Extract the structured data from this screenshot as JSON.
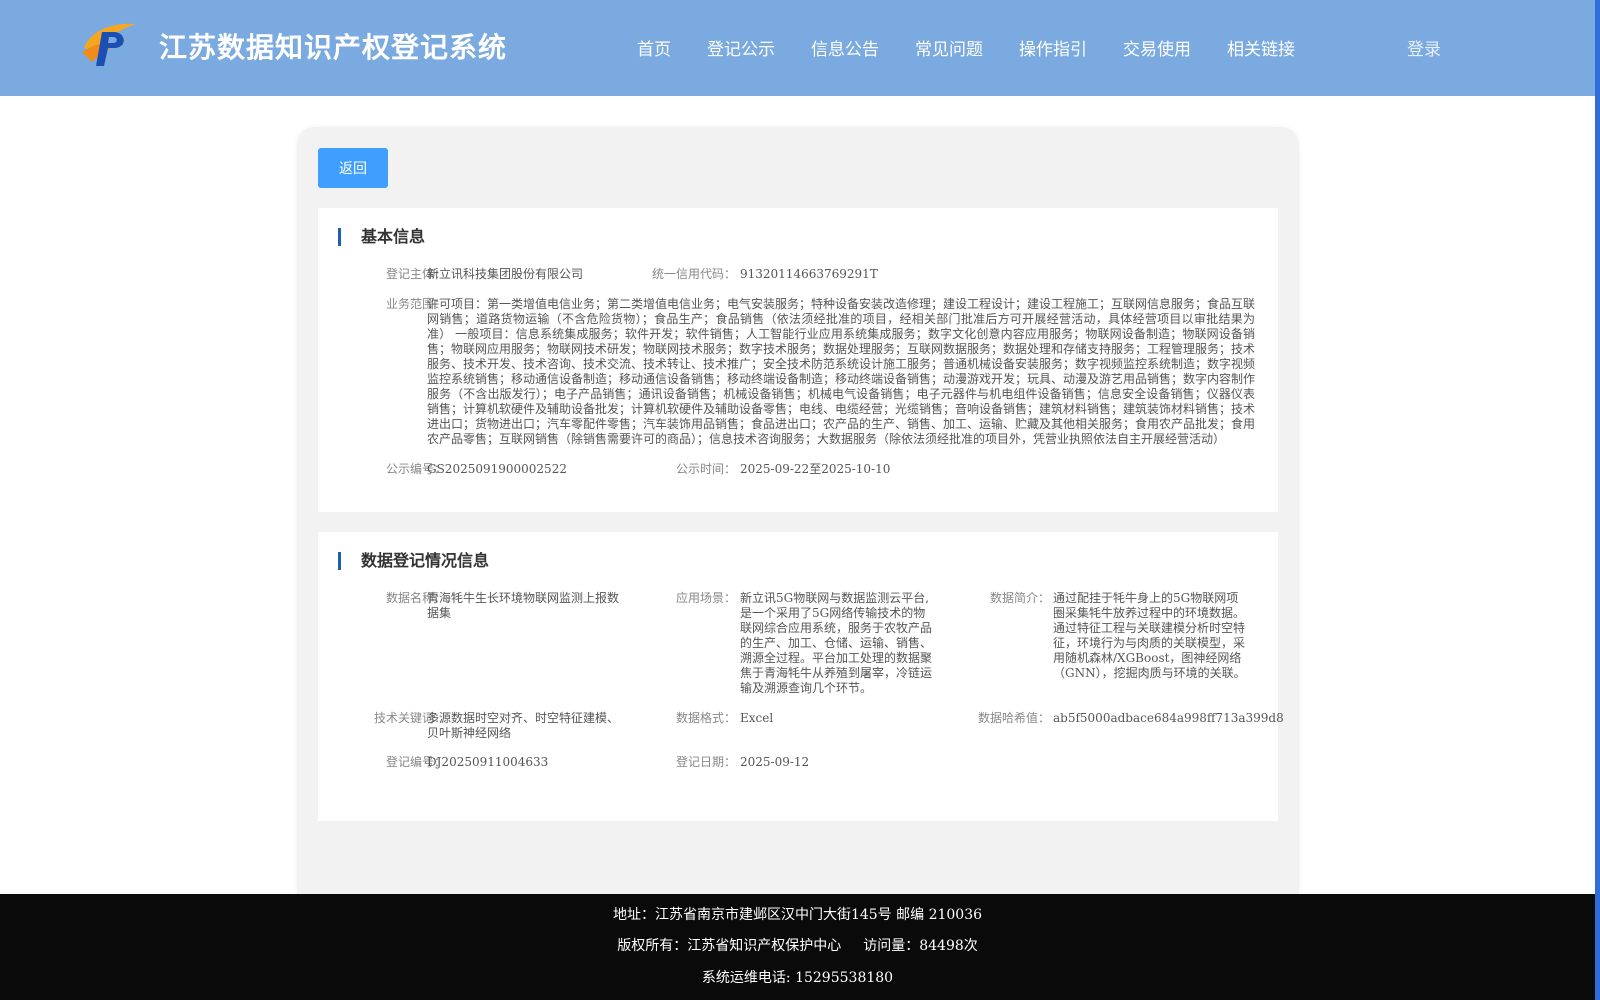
{
  "header": {
    "title": "江苏数据知识产权登记系统",
    "nav": [
      "首页",
      "登记公示",
      "信息公告",
      "常见问题",
      "操作指引",
      "交易使用",
      "相关链接"
    ],
    "login": "登录",
    "colors": {
      "header_bg": "#7aaadf",
      "accent": "#409eff",
      "strip": "#2d6fd6"
    }
  },
  "back_label": "返回",
  "basic": {
    "title": "基本信息",
    "subject_label": "登记主体：",
    "subject": "新立讯科技集团股份有限公司",
    "credit_label": "统一信用代码：",
    "credit": "91320114663769291T",
    "scope_label": "业务范围：",
    "scope": "许可项目：第一类增值电信业务；第二类增值电信业务；电气安装服务；特种设备安装改造修理；建设工程设计；建设工程施工；互联网信息服务；食品互联网销售；道路货物运输（不含危险货物）；食品生产；食品销售（依法须经批准的项目，经相关部门批准后方可开展经营活动，具体经营项目以审批结果为准） 一般项目：信息系统集成服务；软件开发；软件销售；人工智能行业应用系统集成服务；数字文化创意内容应用服务；物联网设备制造；物联网设备销售；物联网应用服务；物联网技术研发；物联网技术服务；数字技术服务；数据处理服务；互联网数据服务；数据处理和存储支持服务；工程管理服务；技术服务、技术开发、技术咨询、技术交流、技术转让、技术推广；安全技术防范系统设计施工服务；普通机械设备安装服务；数字视频监控系统制造；数字视频监控系统销售；移动通信设备制造；移动通信设备销售；移动终端设备制造；移动终端设备销售；动漫游戏开发；玩具、动漫及游艺用品销售；数字内容制作服务（不含出版发行）；电子产品销售；通讯设备销售；机械设备销售；机械电气设备销售；电子元器件与机电组件设备销售；信息安全设备销售；仪器仪表销售；计算机软硬件及辅助设备批发；计算机软硬件及辅助设备零售；电线、电缆经营；光缆销售；音响设备销售；建筑材料销售；建筑装饰材料销售；技术进出口；货物进出口；汽车零配件零售；汽车装饰用品销售；食品进出口；农产品的生产、销售、加工、运输、贮藏及其他相关服务；食用农产品批发；食用农产品零售；互联网销售（除销售需要许可的商品）；信息技术咨询服务；大数据服务（除依法须经批准的项目外，凭营业执照依法自主开展经营活动）",
    "pub_no_label": "公示编号：",
    "pub_no": "GS2025091900002522",
    "pub_time_label": "公示时间：",
    "pub_start": "2025-09-22",
    "pub_to": "至",
    "pub_end": "2025-10-10"
  },
  "reg": {
    "title": "数据登记情况信息",
    "name_label": "数据名称：",
    "name": "青海牦牛生长环境物联网监测上报数据集",
    "scene_label": "应用场景：",
    "scene": "新立讯5G物联网与数据监测云平台,是一个采用了5G网络传输技术的物联网综合应用系统，服务于农牧产品的生产、加工、仓储、运输、销售、溯源全过程。平台加工处理的数据聚焦于青海牦牛从养殖到屠宰，冷链运输及溯源查询几个环节。",
    "intro_label": "数据简介：",
    "intro": "通过配挂于牦牛身上的5G物联网项圈采集牦牛放养过程中的环境数据。通过特征工程与关联建模分析时空特征，环境行为与肉质的关联模型，采用随机森林/XGBoost，图神经网络（GNN），挖掘肉质与环境的关联。",
    "keywords_label": "技术关键词：",
    "keywords": "多源数据时空对齐、时空特征建模、贝叶斯神经网络",
    "format_label": "数据格式：",
    "format": "Excel",
    "hash_label": "数据哈希值：",
    "hash": "ab5f5000adbace684a998ff713a399d8",
    "reg_no_label": "登记编号：",
    "reg_no": "DJ20250911004633",
    "reg_date_label": "登记日期：",
    "reg_date": "2025-09-12"
  },
  "footer": {
    "address": "地址：江苏省南京市建邺区汉中门大街145号 邮编 210036",
    "copyright": "版权所有：江苏省知识产权保护中心",
    "visits": "访问量：84498次",
    "phone": "系统运维电话: 15295538180"
  }
}
